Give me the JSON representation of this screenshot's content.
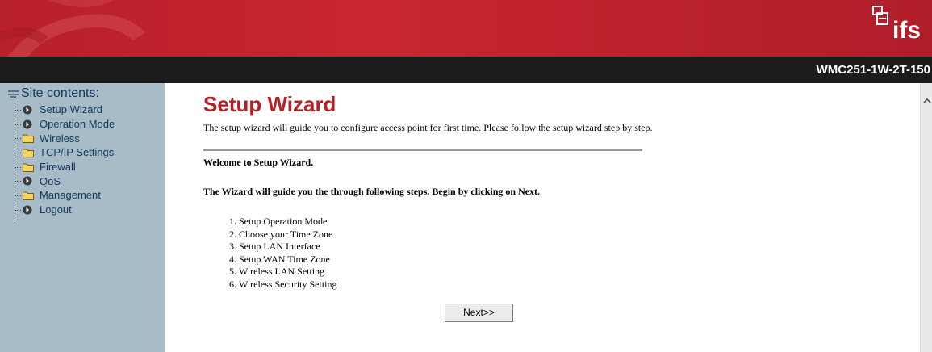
{
  "header": {
    "logo_text": "ifs",
    "model_name": "WMC251-1W-2T-150"
  },
  "sidebar": {
    "title": "Site contents:",
    "items": [
      {
        "label": "Setup Wizard",
        "icon": "arrow-circle-icon"
      },
      {
        "label": "Operation Mode",
        "icon": "arrow-circle-icon"
      },
      {
        "label": "Wireless",
        "icon": "folder-icon"
      },
      {
        "label": "TCP/IP Settings",
        "icon": "folder-icon"
      },
      {
        "label": "Firewall",
        "icon": "folder-icon"
      },
      {
        "label": "QoS",
        "icon": "arrow-circle-icon"
      },
      {
        "label": "Management",
        "icon": "folder-icon"
      },
      {
        "label": "Logout",
        "icon": "arrow-circle-icon"
      }
    ]
  },
  "main": {
    "title": "Setup Wizard",
    "description": "The setup wizard will guide you to configure access point for first time. Please follow the setup wizard step by step.",
    "welcome": "Welcome to Setup Wizard.",
    "guide": "The Wizard will guide you the through following steps. Begin by clicking on Next.",
    "steps": [
      "Setup Operation Mode",
      "Choose your Time Zone",
      "Setup LAN Interface",
      "Setup WAN Time Zone",
      "Wireless LAN Setting",
      "Wireless Security Setting"
    ],
    "next_label": "Next>>"
  },
  "colors": {
    "banner_red": "#c8262f",
    "title_red": "#b32025",
    "sidebar_bg": "#a8bcc8",
    "model_bar": "#1c1c1c",
    "folder_yellow": "#f4d35e"
  }
}
